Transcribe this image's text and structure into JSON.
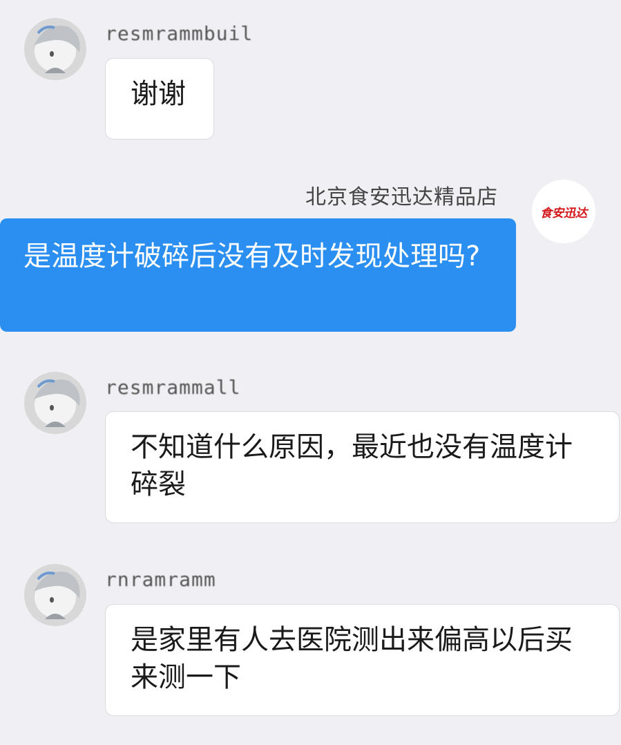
{
  "messages": [
    {
      "sender": "resmrammbuil",
      "text": "谢谢",
      "direction": "incoming"
    },
    {
      "sender": "北京食安迅达精品店",
      "text": "是温度计破碎后没有及时发现处理吗?",
      "direction": "outgoing",
      "avatar_text": "食安迅达"
    },
    {
      "sender": "resmrammall",
      "text": "不知道什么原因，最近也没有温度计碎裂",
      "direction": "incoming"
    },
    {
      "sender": "rnramramm",
      "text": "是家里有人去医院测出来偏高以后买来测一下",
      "direction": "incoming"
    }
  ],
  "colors": {
    "background": "#efeff4",
    "outgoing_bubble": "#2a8ff0",
    "incoming_bubble": "#ffffff",
    "logo_red": "#d4161a"
  }
}
